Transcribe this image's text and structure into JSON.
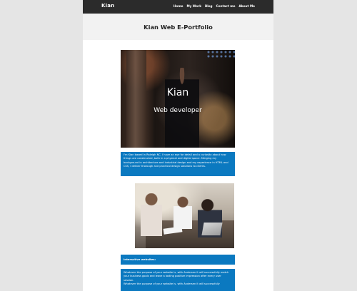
{
  "header": {
    "brand": "Kian",
    "nav": [
      "Home",
      "My Work",
      "Blog",
      "Contact me",
      "About Me"
    ]
  },
  "site_title": "Kian Web E-Portfolio",
  "hero": {
    "name": "Kian",
    "role": "Web developer"
  },
  "intro": "I'm Kian based in Raleigh NC. I have an eye for detail and a curiosity about how things are constructed, both in a physical and digital space. Merging my background in architecture and industrial design and my experience in HTML and CSS, I deliver thorough and practical design solutions to clients.",
  "section": {
    "title": "Interactive websites:",
    "paragraphs": [
      "Whatever the purpose of your website is, with Andersen it will successfully match your business goals and leave a lasting positive impression after every user session.",
      "Whatever the purpose of your website is, with Andersen it will successfully"
    ]
  },
  "colors": {
    "topbar": "#2b2b2b",
    "accent_blue": "#0b79c0",
    "band": "#f2f2f2",
    "backdrop": "#e5e5e5"
  }
}
